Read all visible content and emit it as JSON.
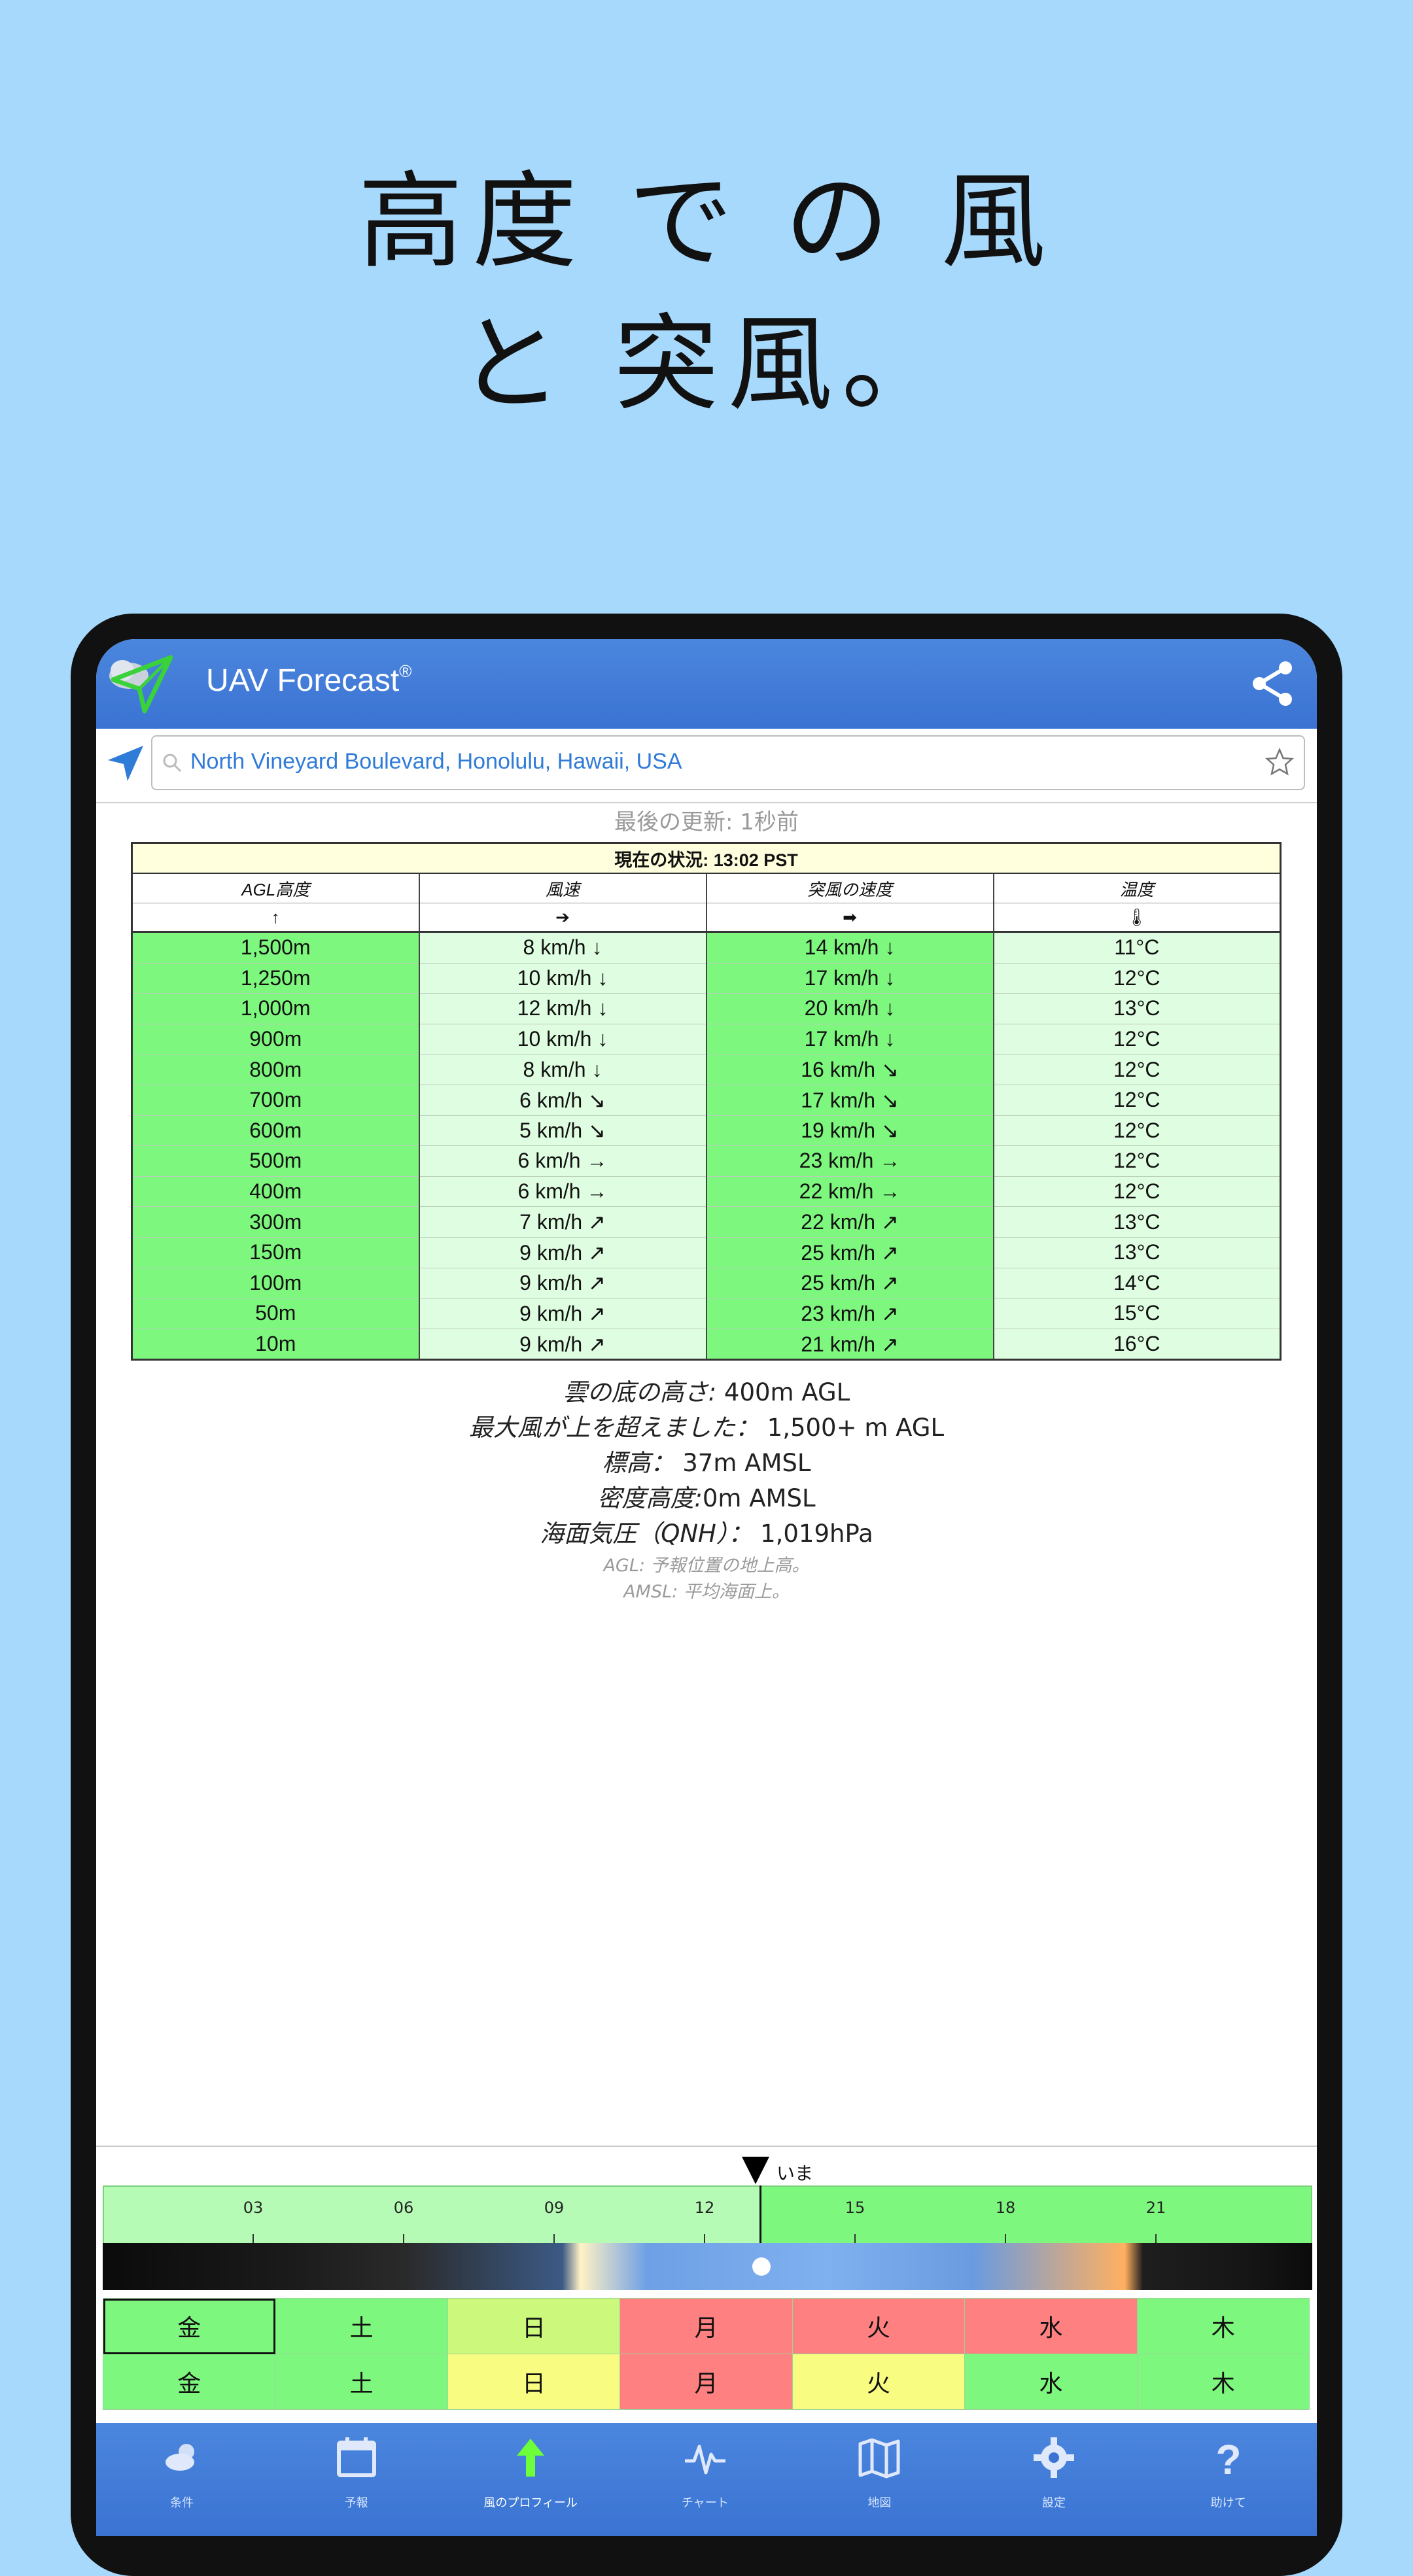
{
  "headline": {
    "line1": "高度 で の 風",
    "line2": "と 突風。"
  },
  "app": {
    "title": "UAV Forecast",
    "registered": "®"
  },
  "search": {
    "value": "North Vineyard Boulevard, Honolulu, Hawaii, USA"
  },
  "last_update": "最後の更新: 1秒前",
  "table": {
    "current": "現在の状況: 13:02 PST",
    "headers": [
      "AGL高度",
      "風速",
      "突風の速度",
      "温度"
    ],
    "header_arrows": [
      "🠕",
      "➔",
      "➡",
      "🌡"
    ],
    "rows": [
      {
        "alt": "1,500m",
        "wind": "8 km/h ↓",
        "gust": "14 km/h ↓",
        "temp": "11°C"
      },
      {
        "alt": "1,250m",
        "wind": "10 km/h ↓",
        "gust": "17 km/h ↓",
        "temp": "12°C"
      },
      {
        "alt": "1,000m",
        "wind": "12 km/h ↓",
        "gust": "20 km/h ↓",
        "temp": "13°C"
      },
      {
        "alt": "900m",
        "wind": "10 km/h ↓",
        "gust": "17 km/h ↓",
        "temp": "12°C"
      },
      {
        "alt": "800m",
        "wind": "8 km/h ↓",
        "gust": "16 km/h ↘",
        "temp": "12°C"
      },
      {
        "alt": "700m",
        "wind": "6 km/h ↘",
        "gust": "17 km/h ↘",
        "temp": "12°C"
      },
      {
        "alt": "600m",
        "wind": "5 km/h ↘",
        "gust": "19 km/h ↘",
        "temp": "12°C"
      },
      {
        "alt": "500m",
        "wind": "6 km/h →",
        "gust": "23 km/h →",
        "temp": "12°C"
      },
      {
        "alt": "400m",
        "wind": "6 km/h →",
        "gust": "22 km/h →",
        "temp": "12°C"
      },
      {
        "alt": "300m",
        "wind": "7 km/h ↗",
        "gust": "22 km/h ↗",
        "temp": "13°C"
      },
      {
        "alt": "150m",
        "wind": "9 km/h ↗",
        "gust": "25 km/h ↗",
        "temp": "13°C"
      },
      {
        "alt": "100m",
        "wind": "9 km/h ↗",
        "gust": "25 km/h ↗",
        "temp": "14°C"
      },
      {
        "alt": "50m",
        "wind": "9 km/h ↗",
        "gust": "23 km/h ↗",
        "temp": "15°C"
      },
      {
        "alt": "10m",
        "wind": "9 km/h ↗",
        "gust": "21 km/h ↗",
        "temp": "16°C"
      }
    ]
  },
  "info": {
    "cloud_label": "雲の底の高さ:",
    "cloud_value": "400m AGL",
    "maxwind_label": "最大風が上を超えました：",
    "maxwind_value": "1,500+ m AGL",
    "elev_label": "標高：",
    "elev_value": "37m AMSL",
    "density_label": "密度高度:",
    "density_value": "0m AMSL",
    "qnh_label": "海面気圧（QNH）：",
    "qnh_value": "1,019hPa",
    "note_agl": "AGL: 予報位置の地上高。",
    "note_amsl": "AMSL: 平均海面上。"
  },
  "timeline": {
    "now_label": "いま",
    "hours": [
      "03",
      "06",
      "09",
      "12",
      "15",
      "18",
      "21"
    ]
  },
  "days": {
    "row1": [
      {
        "label": "金",
        "color": "#7ef77e"
      },
      {
        "label": "土",
        "color": "#7ef77e"
      },
      {
        "label": "日",
        "color": "#ccf97c"
      },
      {
        "label": "月",
        "color": "#ff8080"
      },
      {
        "label": "火",
        "color": "#ff8080"
      },
      {
        "label": "水",
        "color": "#ff8080"
      },
      {
        "label": "木",
        "color": "#7ef77e"
      }
    ],
    "row2": [
      {
        "label": "金",
        "color": "#7ef77e"
      },
      {
        "label": "土",
        "color": "#7ef77e"
      },
      {
        "label": "日",
        "color": "#f8fc80"
      },
      {
        "label": "月",
        "color": "#ff8080"
      },
      {
        "label": "火",
        "color": "#f8fc80"
      },
      {
        "label": "水",
        "color": "#7ef77e"
      },
      {
        "label": "木",
        "color": "#7ef77e"
      }
    ]
  },
  "nav": [
    {
      "label": "条件",
      "icon": "weather-icon"
    },
    {
      "label": "予報",
      "icon": "calendar-icon"
    },
    {
      "label": "風のプロフィール",
      "icon": "arrow-up-icon"
    },
    {
      "label": "チャート",
      "icon": "pulse-chart-icon"
    },
    {
      "label": "地図",
      "icon": "map-icon"
    },
    {
      "label": "設定",
      "icon": "gear-icon"
    },
    {
      "label": "助けて",
      "icon": "help-icon"
    }
  ],
  "colors": {
    "appbar": "#3a73d2",
    "green": "#7ef77e",
    "light_green": "#dffde0",
    "red": "#ff8080",
    "yellow": "#f8fc80",
    "background": "#a7d9fc"
  }
}
